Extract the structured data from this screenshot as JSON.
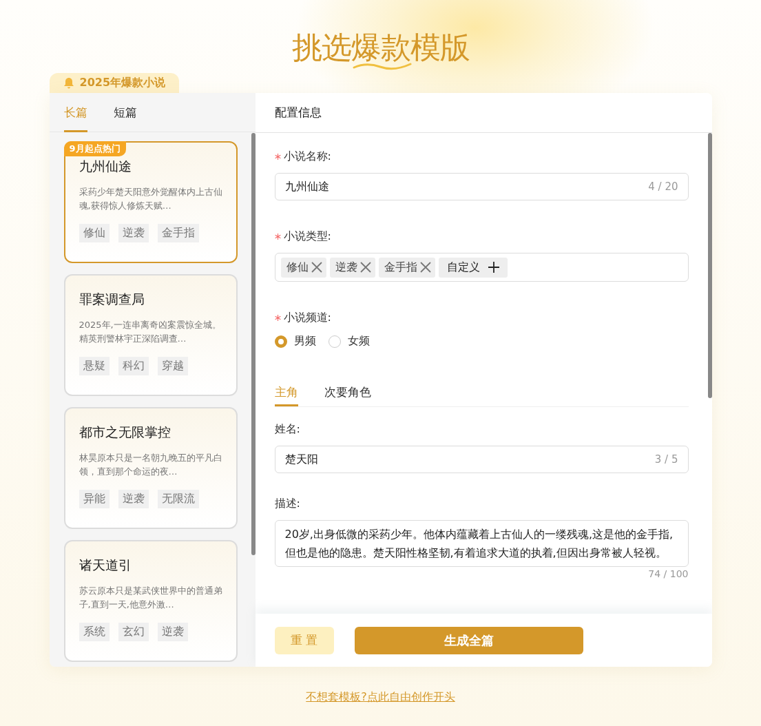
{
  "title": {
    "before": "挑选",
    "highlight": "爆款",
    "after": "模版"
  },
  "badge": "2025年爆款小说",
  "length_tabs": [
    {
      "label": "长篇",
      "selected": true
    },
    {
      "label": "短篇",
      "selected": false
    }
  ],
  "novels": [
    {
      "title": "九州仙途",
      "ribbon": "9月起点热门",
      "description": "采药少年楚天阳意外觉醒体内上古仙魂,获得惊人修炼天赋…",
      "tags": [
        "修仙",
        "逆袭",
        "金手指"
      ],
      "selected": true
    },
    {
      "title": "罪案调查局",
      "description": "2025年,一连串离奇凶案震惊全城。精英刑警林宇正深陷调查…",
      "tags": [
        "悬疑",
        "科幻",
        "穿越"
      ],
      "selected": false
    },
    {
      "title": "都市之无限掌控",
      "description": "林昊原本只是一名朝九晚五的平凡白领，直到那个命运的夜…",
      "tags": [
        "异能",
        "逆袭",
        "无限流"
      ],
      "selected": false
    },
    {
      "title": "诸天道引",
      "description": "苏云原本只是某武侠世界中的普通弟子,直到一天,他意外激…",
      "tags": [
        "系统",
        "玄幻",
        "逆袭"
      ],
      "selected": false
    }
  ],
  "config": {
    "heading": "配置信息",
    "name_field": {
      "label": "小说名称:",
      "required": true,
      "value": "九州仙途",
      "counter": "4 / 20"
    },
    "type_field": {
      "label": "小说类型:",
      "required": true,
      "tags": [
        "修仙",
        "逆袭",
        "金手指"
      ],
      "add_label": "自定义"
    },
    "channel_field": {
      "label": "小说频道:",
      "required": true,
      "options": [
        {
          "label": "男频",
          "selected": true
        },
        {
          "label": "女频",
          "selected": false
        }
      ]
    },
    "role_tabs": [
      {
        "label": "主角",
        "selected": true
      },
      {
        "label": "次要角色",
        "selected": false
      }
    ],
    "role_name": {
      "label": "姓名:",
      "value": "楚天阳",
      "counter": "3 / 5"
    },
    "role_description": {
      "label": "描述:",
      "value": "20岁,出身低微的采药少年。他体内蕴藏着上古仙人的一缕残魂,这是他的金手指,但也是他的隐患。楚天阳性格坚韧,有着追求大道的执着,但因出身常被人轻视。",
      "counter": "74 / 100"
    }
  },
  "buttons": {
    "reset": "重 置",
    "generate": "生成全篇"
  },
  "footer_link": "不想套模板?点此自由创作开头"
}
